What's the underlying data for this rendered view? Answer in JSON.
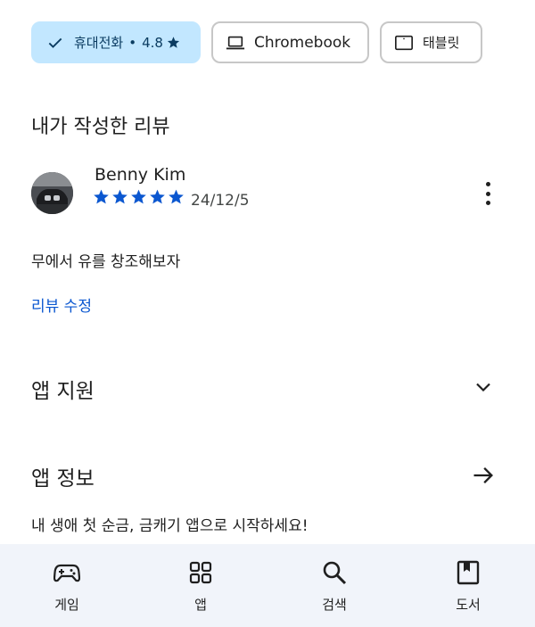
{
  "filters": {
    "phone": {
      "label": "휴대전화",
      "separator": "•",
      "rating": "4.8",
      "icon": "check-icon"
    },
    "chromebook": {
      "label": "Chromebook",
      "icon": "laptop-icon"
    },
    "tablet": {
      "label": "태블릿",
      "icon": "tablet-icon"
    }
  },
  "my_review": {
    "title": "내가 작성한 리뷰",
    "reviewer": "Benny Kim",
    "rating_stars": 5,
    "date": "24/12/5",
    "text": "무에서 유를 창조해보자",
    "edit_label": "리뷰 수정"
  },
  "app_support": {
    "title": "앱 지원"
  },
  "app_info": {
    "title": "앱 정보",
    "description": "내 생애 첫 순금, 금캐기 앱으로 시작하세요!"
  },
  "bottom_nav": [
    {
      "label": "게임",
      "icon": "gamepad-icon"
    },
    {
      "label": "앱",
      "icon": "apps-grid-icon"
    },
    {
      "label": "검색",
      "icon": "search-icon"
    },
    {
      "label": "도서",
      "icon": "book-icon"
    }
  ],
  "colors": {
    "accent": "#0b57d0",
    "chip_selected": "#c2e7ff",
    "nav_bg": "#f1f4fa"
  }
}
